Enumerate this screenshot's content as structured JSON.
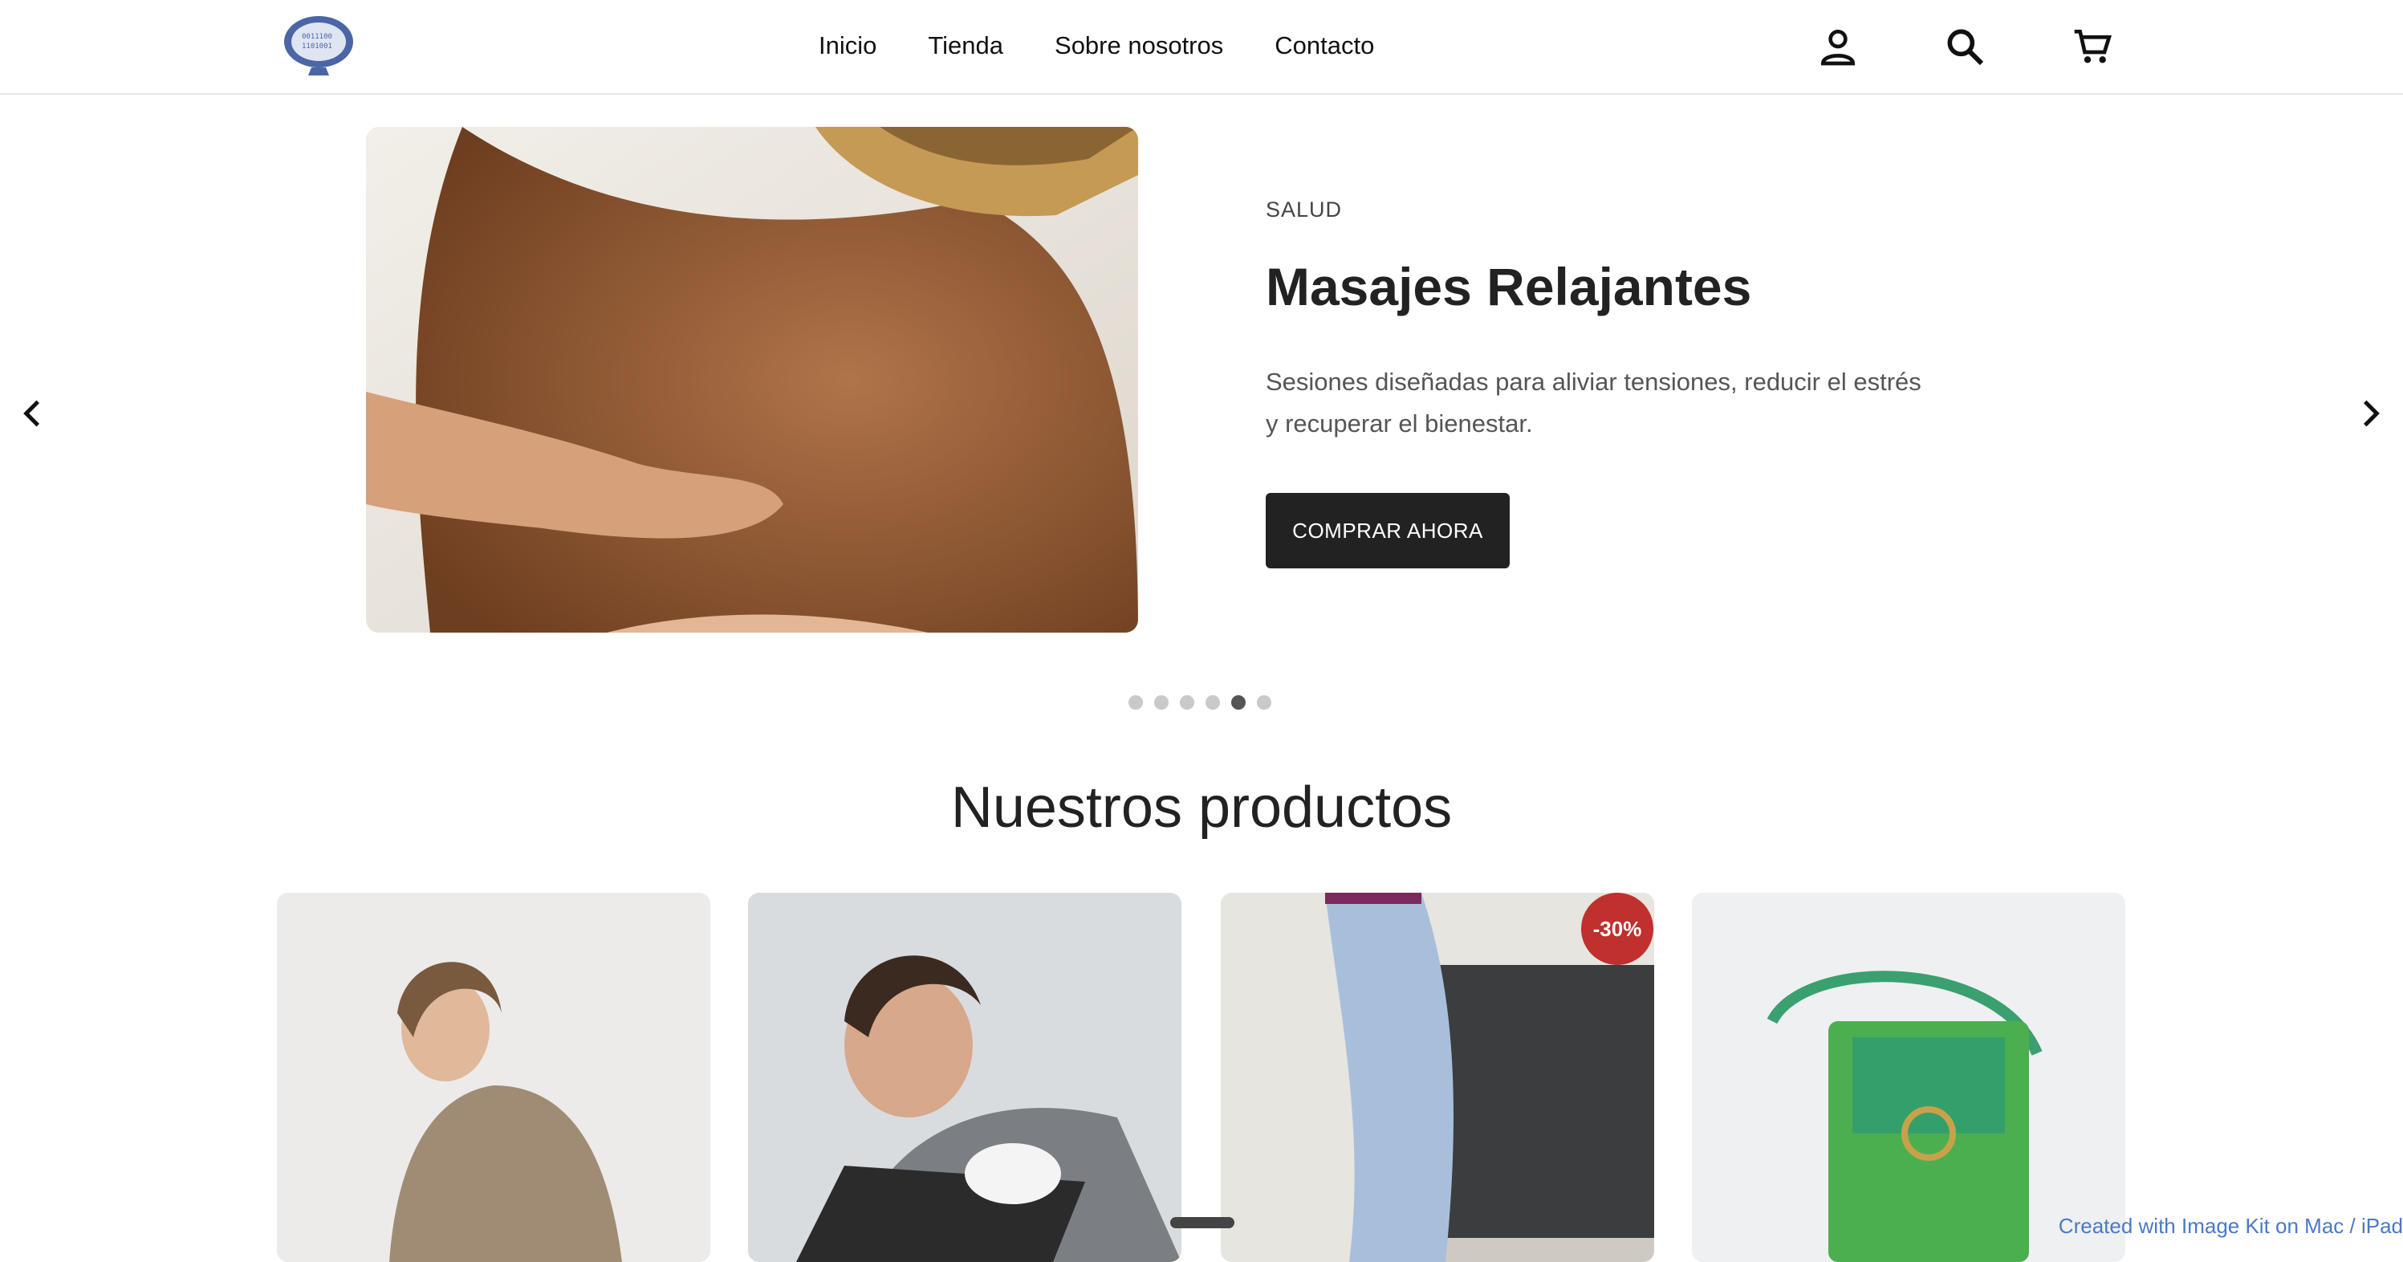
{
  "header": {
    "logo_name": "monitor-logo",
    "nav": [
      "Inicio",
      "Tienda",
      "Sobre nosotros",
      "Contacto"
    ],
    "icons": [
      "user-icon",
      "search-icon",
      "cart-icon"
    ]
  },
  "hero": {
    "eyebrow": "SALUD",
    "title": "Masajes Relajantes",
    "description": "Sesiones diseñadas para aliviar tensiones, reducir el estrés y recuperar el bienestar.",
    "cta": "COMPRAR AHORA",
    "slides_total": 6,
    "active_slide": 5
  },
  "products": {
    "title": "Nuestros productos",
    "items": [
      {
        "name": "hoodie-product"
      },
      {
        "name": "laptop-repair-product"
      },
      {
        "name": "jeans-product",
        "badge": "-30%"
      },
      {
        "name": "green-bag-product"
      }
    ]
  },
  "footer": {
    "credit": "Created with Image Kit on Mac / iPad"
  },
  "colors": {
    "accent_dark": "#222222",
    "badge_red": "#c0302e",
    "credit_blue": "#4a79c8"
  }
}
